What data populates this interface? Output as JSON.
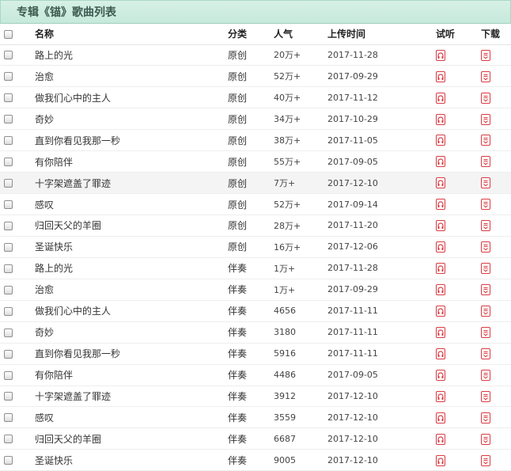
{
  "header": {
    "title": "专辑《锚》歌曲列表"
  },
  "columns": {
    "name": "名称",
    "type": "分类",
    "popularity": "人气",
    "date": "上传时间",
    "play": "试听",
    "download": "下载"
  },
  "icons": {
    "play": "headphones-icon",
    "download": "download-icon",
    "accent": "#d93c44"
  },
  "rows": [
    {
      "name": "路上的光",
      "type": "原创",
      "popularity": "20万+",
      "date": "2017-11-28"
    },
    {
      "name": "治愈",
      "type": "原创",
      "popularity": "52万+",
      "date": "2017-09-29"
    },
    {
      "name": "做我们心中的主人",
      "type": "原创",
      "popularity": "40万+",
      "date": "2017-11-12"
    },
    {
      "name": "奇妙",
      "type": "原创",
      "popularity": "34万+",
      "date": "2017-10-29"
    },
    {
      "name": "直到你看见我那一秒",
      "type": "原创",
      "popularity": "38万+",
      "date": "2017-11-05"
    },
    {
      "name": "有你陪伴",
      "type": "原创",
      "popularity": "55万+",
      "date": "2017-09-05"
    },
    {
      "name": "十字架遮盖了罪迹",
      "type": "原创",
      "popularity": "7万+",
      "date": "2017-12-10"
    },
    {
      "name": "感叹",
      "type": "原创",
      "popularity": "52万+",
      "date": "2017-09-14"
    },
    {
      "name": "归回天父的羊圈",
      "type": "原创",
      "popularity": "28万+",
      "date": "2017-11-20"
    },
    {
      "name": "圣诞快乐",
      "type": "原创",
      "popularity": "16万+",
      "date": "2017-12-06"
    },
    {
      "name": "路上的光",
      "type": "伴奏",
      "popularity": "1万+",
      "date": "2017-11-28"
    },
    {
      "name": "治愈",
      "type": "伴奏",
      "popularity": "1万+",
      "date": "2017-09-29"
    },
    {
      "name": "做我们心中的主人",
      "type": "伴奏",
      "popularity": "4656",
      "date": "2017-11-11"
    },
    {
      "name": "奇妙",
      "type": "伴奏",
      "popularity": "3180",
      "date": "2017-11-11"
    },
    {
      "name": "直到你看见我那一秒",
      "type": "伴奏",
      "popularity": "5916",
      "date": "2017-11-11"
    },
    {
      "name": "有你陪伴",
      "type": "伴奏",
      "popularity": "4486",
      "date": "2017-09-05"
    },
    {
      "name": "十字架遮盖了罪迹",
      "type": "伴奏",
      "popularity": "3912",
      "date": "2017-12-10"
    },
    {
      "name": "感叹",
      "type": "伴奏",
      "popularity": "3559",
      "date": "2017-12-10"
    },
    {
      "name": "归回天父的羊圈",
      "type": "伴奏",
      "popularity": "6687",
      "date": "2017-12-10"
    },
    {
      "name": "圣诞快乐",
      "type": "伴奏",
      "popularity": "9005",
      "date": "2017-12-10"
    }
  ]
}
